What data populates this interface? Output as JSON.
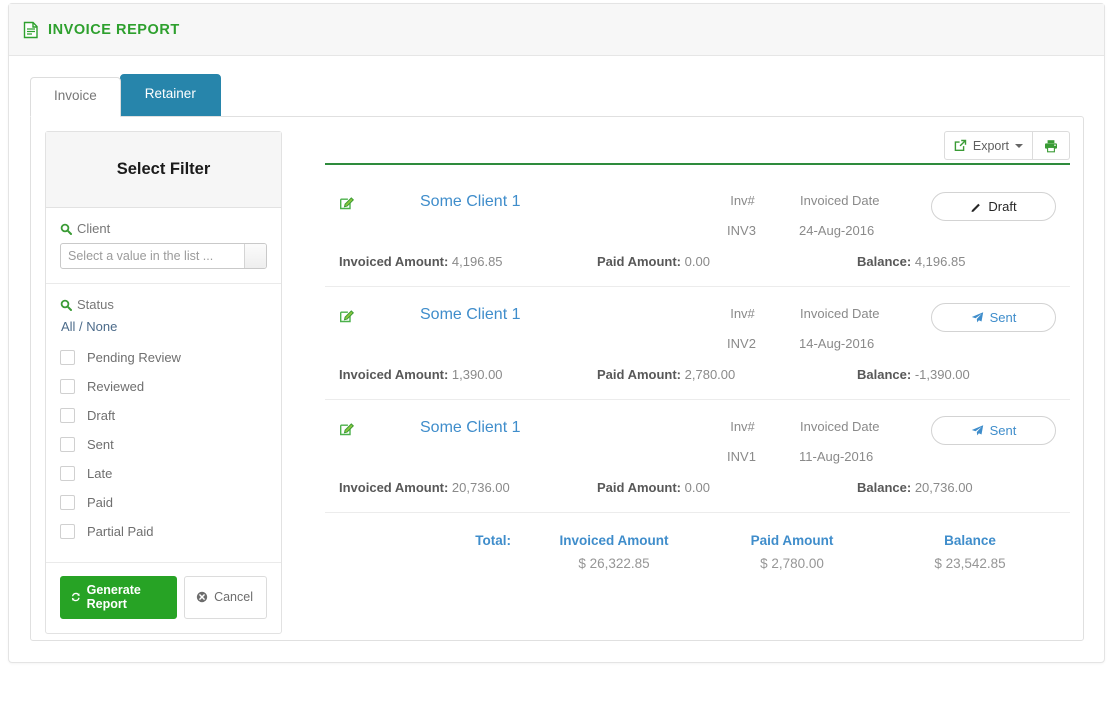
{
  "header": {
    "title": "INVOICE REPORT",
    "icon": "document-report-icon"
  },
  "tabs": [
    {
      "label": "Invoice",
      "active": true
    },
    {
      "label": "Retainer",
      "active": false
    }
  ],
  "filter": {
    "title": "Select Filter",
    "client": {
      "label": "Client",
      "icon": "search-icon",
      "placeholder": "Select a value in the list ...",
      "value": "Select a value in the list ..."
    },
    "status": {
      "label": "Status",
      "icon": "search-icon",
      "all_none": "All / None",
      "options": [
        {
          "label": "Pending Review",
          "checked": false
        },
        {
          "label": "Reviewed",
          "checked": false
        },
        {
          "label": "Draft",
          "checked": false
        },
        {
          "label": "Sent",
          "checked": false
        },
        {
          "label": "Late",
          "checked": false
        },
        {
          "label": "Paid",
          "checked": false
        },
        {
          "label": "Partial Paid",
          "checked": false
        }
      ]
    },
    "actions": {
      "generate_label": "Generate Report",
      "generate_icon": "refresh-icon",
      "cancel_label": "Cancel",
      "cancel_icon": "cancel-circle-icon"
    }
  },
  "toolbar": {
    "export_label": "Export",
    "export_icon": "external-link-icon",
    "print_icon": "printer-icon"
  },
  "columns": {
    "inv_no": "Inv#",
    "invoiced_date": "Invoiced Date",
    "invoiced_amount": "Invoiced Amount:",
    "paid_amount": "Paid Amount:",
    "balance": "Balance:"
  },
  "rows": [
    {
      "client": "Some Client 1",
      "inv_no_label": "Inv#",
      "inv_no": "INV3",
      "date_label": "Invoiced Date",
      "date": "24-Aug-2016",
      "invoiced_amount": "4,196.85",
      "paid_amount": "0.00",
      "balance": "4,196.85",
      "status": "Draft",
      "status_icon": "pencil-icon",
      "edit_icon": "edit-icon"
    },
    {
      "client": "Some Client 1",
      "inv_no_label": "Inv#",
      "inv_no": "INV2",
      "date_label": "Invoiced Date",
      "date": "14-Aug-2016",
      "invoiced_amount": "1,390.00",
      "paid_amount": "2,780.00",
      "balance": "-1,390.00",
      "status": "Sent",
      "status_icon": "paper-plane-icon",
      "edit_icon": "edit-icon"
    },
    {
      "client": "Some Client 1",
      "inv_no_label": "Inv#",
      "inv_no": "INV1",
      "date_label": "Invoiced Date",
      "date": "11-Aug-2016",
      "invoiced_amount": "20,736.00",
      "paid_amount": "0.00",
      "balance": "20,736.00",
      "status": "Sent",
      "status_icon": "paper-plane-icon",
      "edit_icon": "edit-icon"
    }
  ],
  "totals": {
    "label": "Total:",
    "invoiced_amount_head": "Invoiced Amount",
    "invoiced_amount_value": "$  26,322.85",
    "paid_amount_head": "Paid Amount",
    "paid_amount_value": "$  2,780.00",
    "balance_head": "Balance",
    "balance_value": "$  23,542.85"
  },
  "colors": {
    "brand_green": "#2ea02e",
    "accent_blue": "#3f8dcb",
    "tab_active_blue": "#2785ab",
    "button_green": "#27a325",
    "rule_green": "#2e8b3c"
  }
}
